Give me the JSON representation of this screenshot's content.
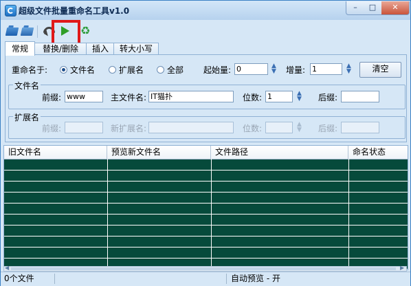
{
  "window": {
    "title": "超级文件批量重命名工具v1.0",
    "controls": {
      "minimize": "–",
      "maximize": "□",
      "close": "✕"
    }
  },
  "toolbar": {
    "icons": [
      "open-folder-icon",
      "open-file-icon",
      "undo-icon",
      "play-icon",
      "recycle-icon"
    ],
    "highlight_color": "#e01919"
  },
  "tabs": [
    {
      "label": "常规",
      "active": true
    },
    {
      "label": "替换/删除",
      "active": false
    },
    {
      "label": "插入",
      "active": false
    },
    {
      "label": "转大小写",
      "active": false
    }
  ],
  "rename": {
    "label": "重命名于:",
    "options": [
      {
        "label": "文件名",
        "selected": true
      },
      {
        "label": "扩展名",
        "selected": false
      },
      {
        "label": "全部",
        "selected": false
      }
    ],
    "start_label": "起始量:",
    "start_value": "0",
    "step_label": "增量:",
    "step_value": "1",
    "clear_label": "清空"
  },
  "filename_group": {
    "title": "文件名",
    "prefix_label": "前缀:",
    "prefix_value": "www",
    "main_label": "主文件名:",
    "main_value": "IT猫扑",
    "digits_label": "位数:",
    "digits_value": "1",
    "suffix_label": "后缀:",
    "suffix_value": ""
  },
  "ext_group": {
    "title": "扩展名",
    "prefix_label": "前缀:",
    "new_ext_label": "新扩展名:",
    "digits_label": "位数:",
    "suffix_label": "后缀:"
  },
  "table": {
    "columns": [
      "旧文件名",
      "预览新文件名",
      "文件路径",
      "命名状态"
    ],
    "row_color": "#064a3b"
  },
  "status": {
    "file_count": "0个文件",
    "preview": "自动预览 - 开"
  },
  "colors": {
    "window_bg": "#d6e7f6",
    "accent": "#3a80c4",
    "play_green": "#2f9e28"
  }
}
